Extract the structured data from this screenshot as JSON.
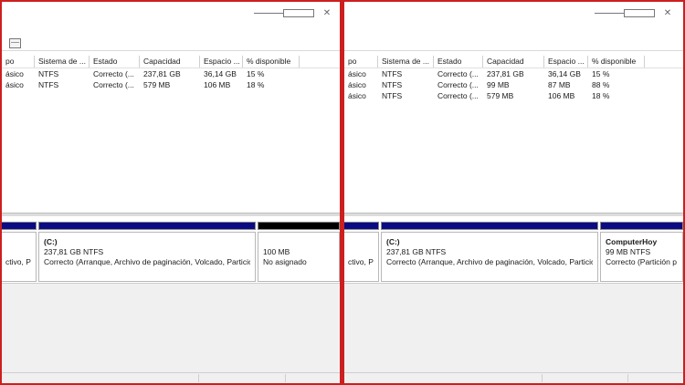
{
  "window_controls": {
    "minimize": "",
    "maximize": "",
    "close": "✕"
  },
  "columns": [
    "po",
    "Sistema de ...",
    "Estado",
    "Capacidad",
    "Espacio ...",
    "% disponible"
  ],
  "left": {
    "rows": [
      [
        "ásico",
        "NTFS",
        "Correcto (...",
        "237,81 GB",
        "36,14 GB",
        "15 %"
      ],
      [
        "ásico",
        "NTFS",
        "Correcto (...",
        "579 MB",
        "106 MB",
        "18 %"
      ]
    ],
    "partitions": [
      {
        "line1": "ctivo, Par"
      },
      {
        "name": "(C:)",
        "line2": "237,81 GB NTFS",
        "line3": "Correcto (Arranque, Archivo de paginación, Volcado, Partición"
      },
      {
        "line2": "100 MB",
        "line3": "No asignado"
      }
    ]
  },
  "right": {
    "rows": [
      [
        "ásico",
        "NTFS",
        "Correcto (...",
        "237,81 GB",
        "36,14 GB",
        "15 %"
      ],
      [
        "ásico",
        "NTFS",
        "Correcto (...",
        "99 MB",
        "87 MB",
        "88 %"
      ],
      [
        "ásico",
        "NTFS",
        "Correcto (...",
        "579 MB",
        "106 MB",
        "18 %"
      ]
    ],
    "partitions": [
      {
        "line1": "ctivo, Par"
      },
      {
        "name": "(C:)",
        "line2": "237,81 GB NTFS",
        "line3": "Correcto (Arranque, Archivo de paginación, Volcado, Partición"
      },
      {
        "name": "ComputerHoy",
        "line2": "99 MB NTFS",
        "line3": "Correcto (Partición p"
      }
    ]
  }
}
